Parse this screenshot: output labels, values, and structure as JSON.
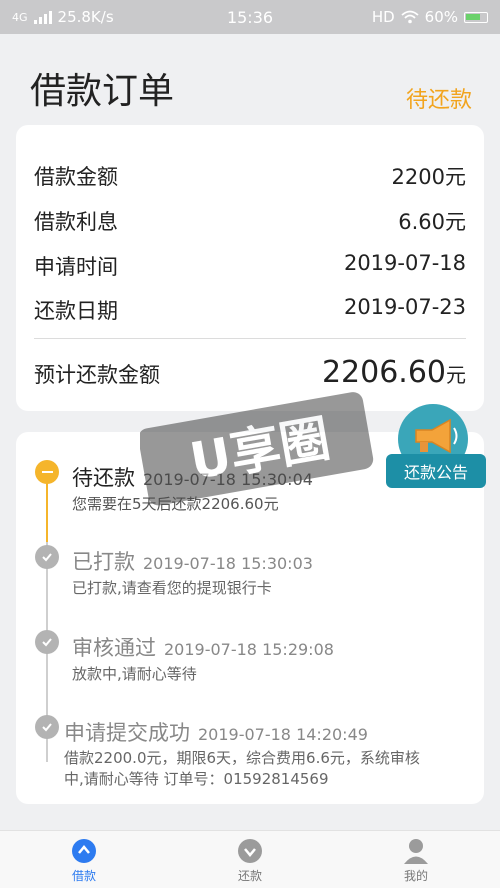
{
  "status_bar": {
    "network": "4G",
    "speed": "25.8K/s",
    "time": "15:36",
    "hd": "HD",
    "battery": "60%"
  },
  "header": {
    "title": "借款订单",
    "status": "待还款"
  },
  "summary": {
    "rows": [
      {
        "label": "借款金额",
        "value": "2200元"
      },
      {
        "label": "借款利息",
        "value": "6.60元"
      },
      {
        "label": "申请时间",
        "value": "2019-07-18"
      },
      {
        "label": "还款日期",
        "value": "2019-07-23"
      }
    ],
    "total_label": "预计还款金额",
    "total_value": "2206.60",
    "total_unit": "元"
  },
  "timeline": [
    {
      "title": "待还款",
      "time": "2019-07-18 15:30:04",
      "desc": "您需要在5天后还款2206.60元"
    },
    {
      "title": "已打款",
      "time": "2019-07-18 15:30:03",
      "desc": "已打款,请查看您的提现银行卡"
    },
    {
      "title": "审核通过",
      "time": "2019-07-18 15:29:08",
      "desc": "放款中,请耐心等待"
    },
    {
      "title": "申请提交成功",
      "time": "2019-07-18 14:20:49",
      "desc1": "借款2200.0元，期限6天，综合费用6.6元，系统审核",
      "desc2": "中,请耐心等待 订单号：01592814569"
    }
  ],
  "notice": {
    "label": "还款公告"
  },
  "watermark": {
    "text": "U享圈"
  },
  "tabbar": {
    "items": [
      {
        "label": "借款"
      },
      {
        "label": "还款"
      },
      {
        "label": "我的"
      }
    ]
  },
  "colors": {
    "accent": "#f2a41e",
    "active_tab": "#2d7bf0",
    "notice": "#1d8fa6"
  }
}
